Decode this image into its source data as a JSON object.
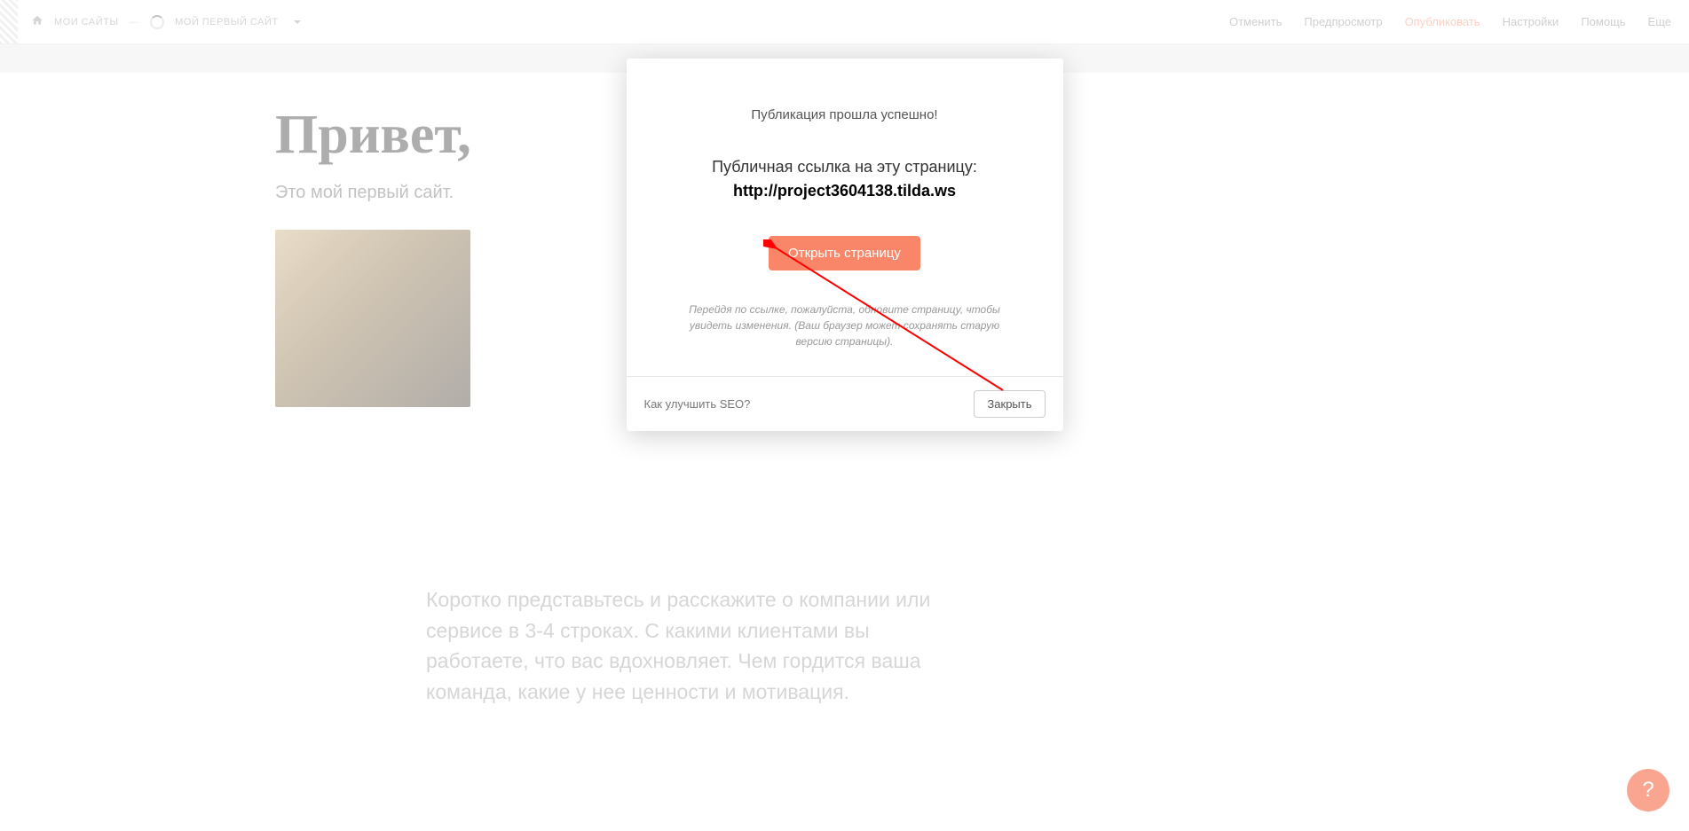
{
  "header": {
    "breadcrumb_my_sites": "МОИ САЙТЫ",
    "breadcrumb_current": "МОЙ ПЕРВЫЙ САЙТ",
    "nav": {
      "cancel": "Отменить",
      "preview": "Предпросмотр",
      "publish": "Опубликовать",
      "settings": "Настройки",
      "help": "Помощь",
      "more": "Еще"
    }
  },
  "page": {
    "hero_title": "Привет,",
    "hero_subtitle": "Это мой первый сайт.",
    "body_text": "Коротко представьтесь и расскажите о компании или сервисе в 3-4 строках. С какими клиентами вы работаете, что вас вдохновляет. Чем гордится ваша команда, какие у нее ценности и мотивация."
  },
  "modal": {
    "success_message": "Публикация прошла успешно!",
    "link_label": "Публичная ссылка на эту страницу:",
    "public_url": "http://project3604138.tilda.ws",
    "open_button": "Открыть страницу",
    "hint": "Перейдя по ссылке, пожалуйста, обновите страницу, чтобы увидеть изменения. (Ваш браузер может сохранять старую версию страницы).",
    "seo_link": "Как улучшить SEO?",
    "close_button": "Закрыть"
  },
  "help_bubble": "?"
}
